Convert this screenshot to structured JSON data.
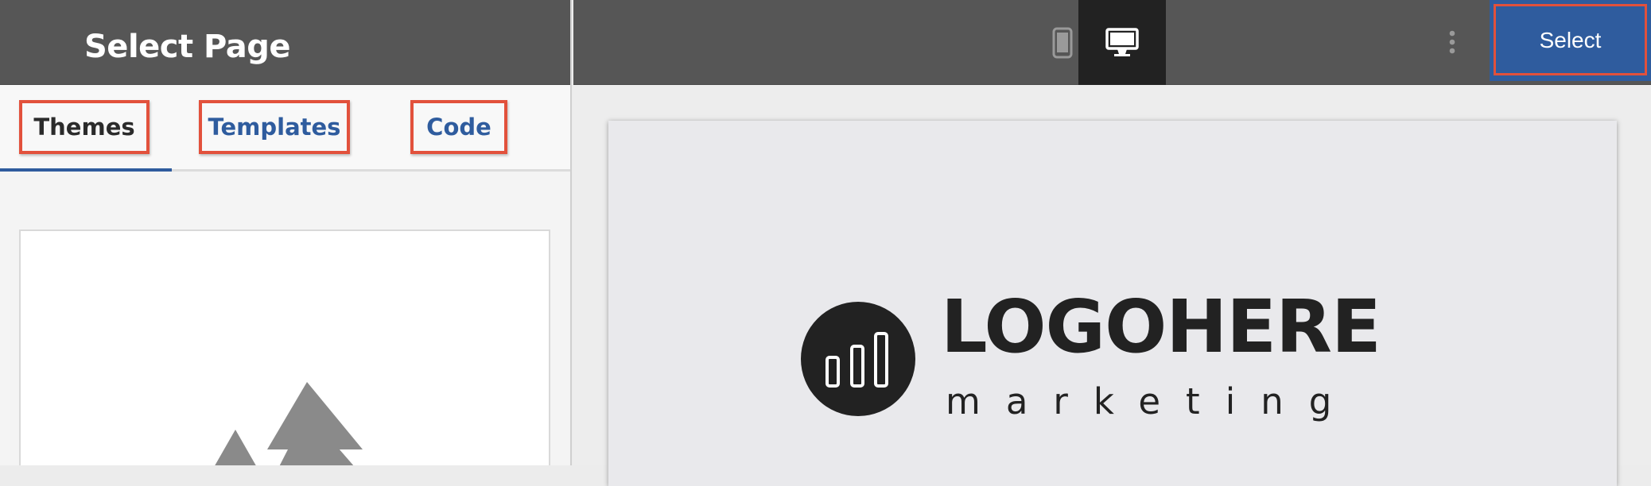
{
  "sidebar": {
    "title": "Select Page",
    "tabs": [
      {
        "label": "Themes",
        "active": true
      },
      {
        "label": "Templates",
        "active": false
      },
      {
        "label": "Code",
        "active": false
      }
    ],
    "theme_card": {
      "icon": "image-placeholder-icon"
    }
  },
  "toolbar": {
    "devices": [
      {
        "icon": "mobile-device-icon",
        "active": false
      },
      {
        "icon": "desktop-monitor-icon",
        "active": true
      }
    ],
    "more_icon": "vertical-dots-icon",
    "select_label": "Select"
  },
  "preview": {
    "logo_title": "LOGOHERE",
    "logo_subtitle": "marketing",
    "logo_icon": "bar-chart-circle-icon"
  },
  "colors": {
    "header_bg": "#565656",
    "accent_blue": "#2f5c9e",
    "highlight_red": "#e2513c",
    "active_device_bg": "#222222"
  }
}
